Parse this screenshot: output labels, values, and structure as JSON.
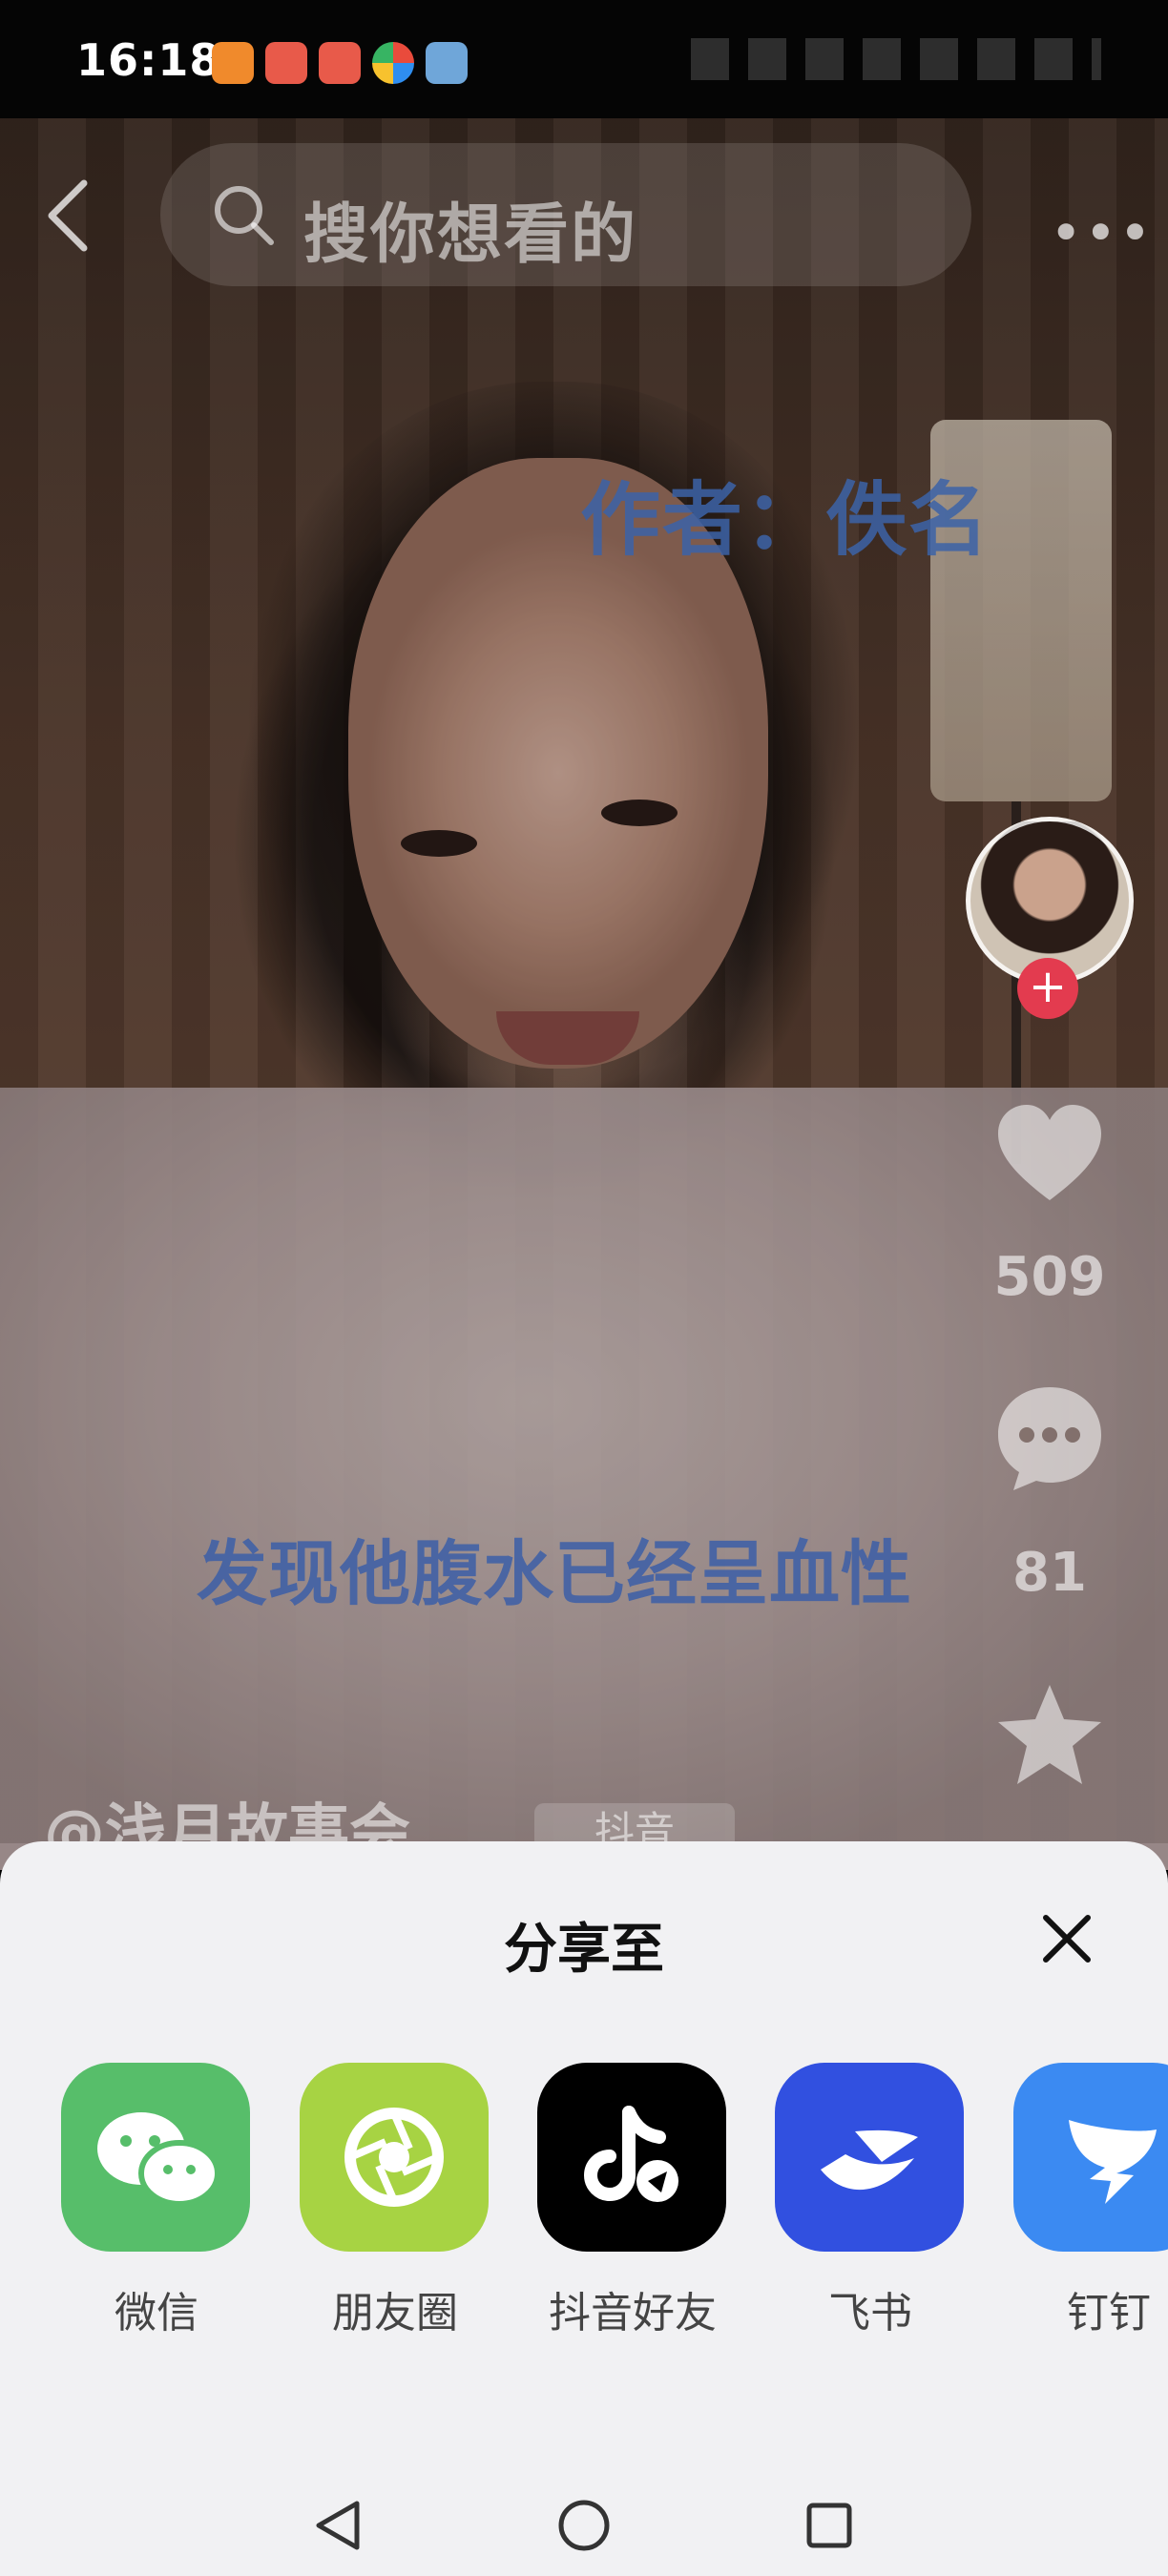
{
  "status_bar": {
    "time": "16:18"
  },
  "search": {
    "placeholder": "搜你想看的"
  },
  "video": {
    "author_overlay": "作者：佚名",
    "subtitle": "发现他腹水已经呈血性",
    "handle": "@浅月故事会",
    "watermark": "抖音"
  },
  "actions": {
    "likes": "509",
    "comments": "81"
  },
  "share": {
    "title": "分享至",
    "apps": [
      {
        "label": "微信",
        "color": "#57be6a"
      },
      {
        "label": "朋友圈",
        "color": "#a7d343"
      },
      {
        "label": "抖音好友",
        "color": "#000000"
      },
      {
        "label": "飞书",
        "color": "#3150e0"
      },
      {
        "label": "钉钉",
        "color": "#3b8af2"
      }
    ]
  },
  "colors": {
    "follow_badge": "#e33b4f",
    "sheet_bg": "#f1f1f3",
    "overlay_text": "#3c63a8"
  }
}
